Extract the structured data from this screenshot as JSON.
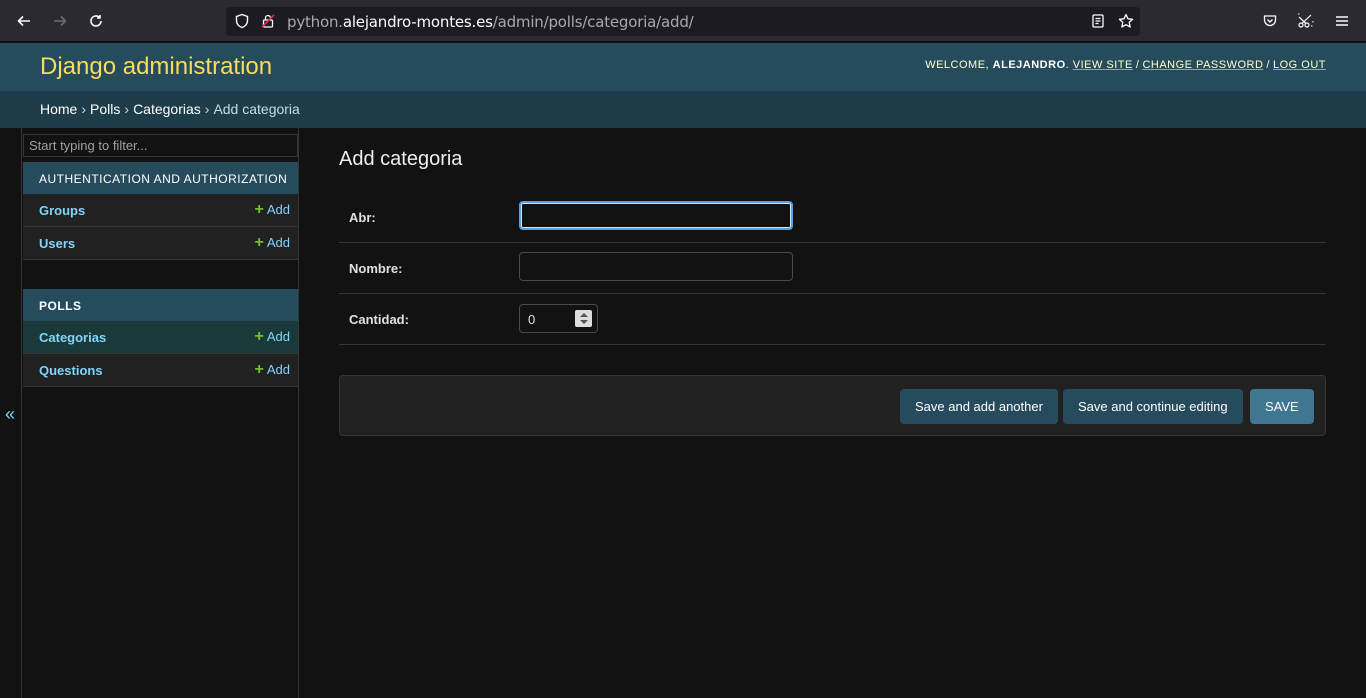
{
  "browser": {
    "url_prefix": "python.",
    "url_domain": "alejandro-montes.es",
    "url_path": "/admin/polls/categoria/add/"
  },
  "header": {
    "branding": "Django administration",
    "welcome": "Welcome,",
    "username": "alejandro",
    "view_site": "View site",
    "change_password": "Change password",
    "log_out": "Log out"
  },
  "breadcrumbs": {
    "home": "Home",
    "app": "Polls",
    "model": "Categorias",
    "current": "Add categoria"
  },
  "sidebar": {
    "collapse": "«",
    "filter_placeholder": "Start typing to filter...",
    "modules": [
      {
        "caption": "Authentication and Authorization",
        "models": [
          {
            "name": "Groups",
            "add": "Add"
          },
          {
            "name": "Users",
            "add": "Add"
          }
        ]
      },
      {
        "caption": "Polls",
        "models": [
          {
            "name": "Categorias",
            "add": "Add"
          },
          {
            "name": "Questions",
            "add": "Add"
          }
        ]
      }
    ]
  },
  "content": {
    "title": "Add categoria",
    "fields": [
      {
        "label": "Abr:",
        "value": ""
      },
      {
        "label": "Nombre:",
        "value": ""
      },
      {
        "label": "Cantidad:",
        "value": "0"
      }
    ],
    "buttons": {
      "save_add_another": "Save and add another",
      "save_continue": "Save and continue editing",
      "save": "SAVE"
    }
  }
}
